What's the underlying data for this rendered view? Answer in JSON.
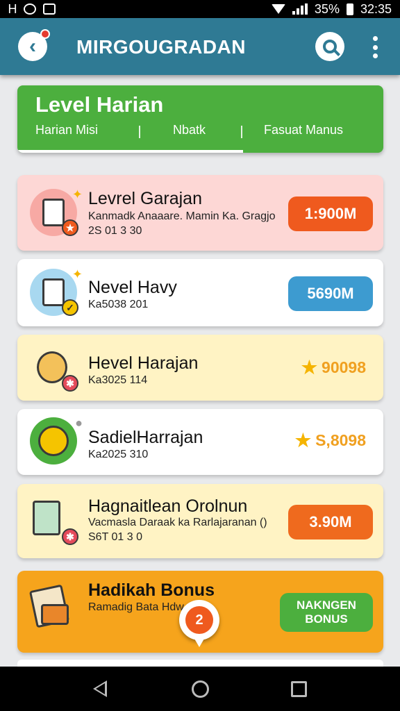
{
  "status_bar": {
    "left_text": "Ꮋ",
    "battery_text": "35%",
    "time": "32:35"
  },
  "app_bar": {
    "title": "MIRGOUGRADAN"
  },
  "hero": {
    "title": "Level Harian",
    "tabs": [
      "Harian Misi",
      "Nbatk",
      "Fasuat Manus"
    ],
    "color": "#4caf3e"
  },
  "cards": [
    {
      "title": "Levrel Garajan",
      "subtitle": "Kanmadk Anaaare. Mamin Ka. Gragjo",
      "subtitle2": "2S 01 3 30",
      "value": "1:900M",
      "value_color": "#ef5a1e",
      "background": "#fdd7d5",
      "icon": "cup-star-icon"
    },
    {
      "title": "Nevel Havy",
      "subtitle": "Ka5038 201",
      "value": "5690M",
      "value_color": "#3d9bd0",
      "background": "#ffffff",
      "icon": "bag-check-icon"
    },
    {
      "title": "Hevel Harajan",
      "subtitle": "Ka3025 114",
      "value": "90098",
      "value_color": "#f0a020",
      "background": "#fff3c4",
      "icon": "onion-icon"
    },
    {
      "title": "SadielHarrajan",
      "subtitle": "Ka2025 310",
      "value": "S,8098",
      "value_color": "#f0a020",
      "background": "#ffffff",
      "icon": "gear-coin-icon"
    },
    {
      "title": "Hagnaitlean Orolnun",
      "subtitle": "Vacmasla Daraak ka Rarlajaranan ()",
      "subtitle2": "S6T 01 3 0",
      "value": "3.90M",
      "value_color": "#ef5a1e",
      "background": "#fff3c4",
      "icon": "jar-heart-icon"
    },
    {
      "title": "Hadikah Bonus",
      "subtitle": "Ramadig Bata Hdw",
      "button_line1": "NAKNGEN",
      "button_line2": "BONUS",
      "background": "#f6a41c",
      "icon": "gift-card-icon"
    }
  ],
  "fab": {
    "label": "2"
  }
}
